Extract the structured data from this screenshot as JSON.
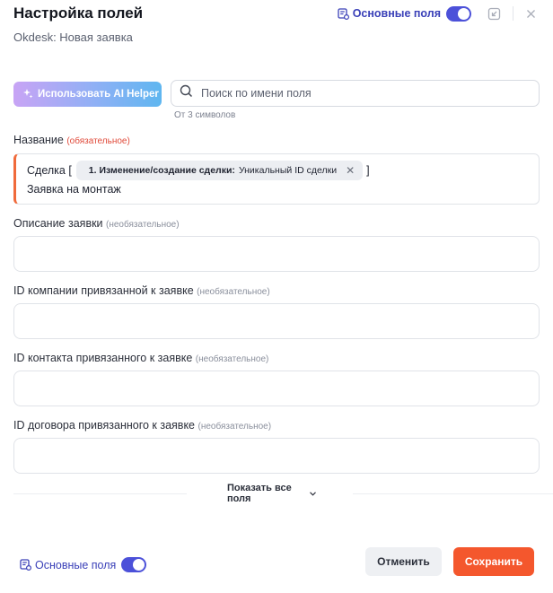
{
  "header": {
    "title": "Настройка полей",
    "subtitle": "Okdesk: Новая заявка",
    "fields_toggle_label": "Основные поля",
    "fields_toggle_on": true
  },
  "toolbar": {
    "ai_helper_label": "Использовать AI Helper",
    "search_placeholder": "Поиск по имени поля",
    "search_value": "",
    "search_hint": "От 3 символов"
  },
  "fields": [
    {
      "label": "Название",
      "qualifier": "(обязательное)",
      "required": true,
      "value_prefix": "Сделка [",
      "chip_step": "1. Изменение/создание сделки:",
      "chip_field": "Уникальный ID сделки",
      "value_suffix": "]",
      "value_line2": "Заявка на монтаж"
    },
    {
      "label": "Описание заявки",
      "qualifier": "(необязательное)",
      "required": false,
      "value": ""
    },
    {
      "label": "ID компании привязанной к заявке",
      "qualifier": "(необязательное)",
      "required": false,
      "value": ""
    },
    {
      "label": "ID контакта привязанного к заявке",
      "qualifier": "(необязательное)",
      "required": false,
      "value": ""
    },
    {
      "label": "ID договора привязанного к заявке",
      "qualifier": "(необязательное)",
      "required": false,
      "value": ""
    }
  ],
  "show_all_label": "Показать все поля",
  "footer": {
    "fields_toggle_label": "Основные поля",
    "fields_toggle_on": true,
    "cancel_label": "Отменить",
    "save_label": "Сохранить"
  },
  "colors": {
    "accent": "#4c51d9",
    "primary_button": "#f4572d",
    "required_marker": "#e04a3a",
    "required_border": "#f06a3b"
  },
  "icons": {
    "fields_toggle": "list-settings-icon",
    "export": "export-icon",
    "close": "close-icon",
    "ai": "sparkle-icon",
    "search": "search-icon",
    "chip_remove": "close-icon",
    "show_all": "chevron-down-icon"
  }
}
